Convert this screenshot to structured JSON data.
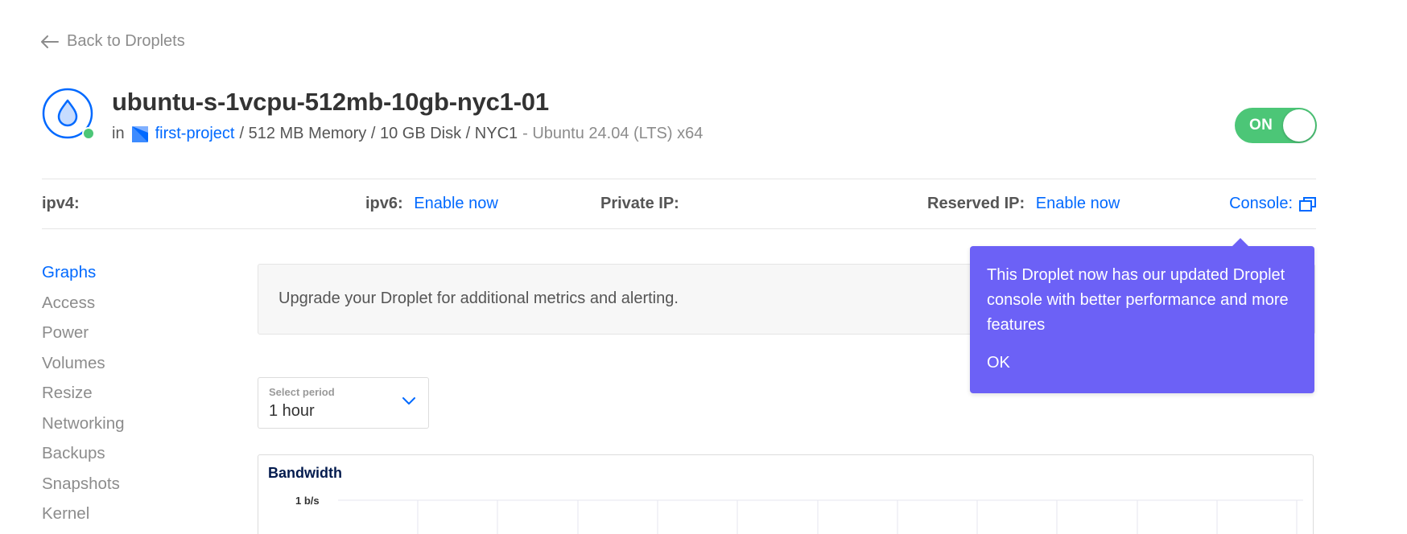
{
  "nav": {
    "back_label": "Back to Droplets"
  },
  "droplet": {
    "name": "ubuntu-s-1vcpu-512mb-10gb-nyc1-01",
    "in_label": "in",
    "project": "first-project",
    "specs": "/ 512 MB Memory / 10 GB Disk / NYC1",
    "os": "- Ubuntu 24.04 (LTS) x64",
    "status_color": "#4cc677"
  },
  "power_toggle": {
    "label": "ON",
    "state": "on",
    "color": "#4cc677"
  },
  "info_bar": {
    "ipv4_label": "ipv4:",
    "ipv6_label": "ipv6:",
    "ipv6_action": "Enable now",
    "private_ip_label": "Private IP:",
    "reserved_ip_label": "Reserved IP:",
    "reserved_ip_action": "Enable now",
    "console_label": "Console:"
  },
  "sidebar": {
    "items": [
      {
        "label": "Graphs",
        "active": true
      },
      {
        "label": "Access",
        "active": false
      },
      {
        "label": "Power",
        "active": false
      },
      {
        "label": "Volumes",
        "active": false
      },
      {
        "label": "Resize",
        "active": false
      },
      {
        "label": "Networking",
        "active": false
      },
      {
        "label": "Backups",
        "active": false
      },
      {
        "label": "Snapshots",
        "active": false
      },
      {
        "label": "Kernel",
        "active": false
      }
    ]
  },
  "banner": {
    "text": "Upgrade your Droplet for additional metrics and alerting."
  },
  "period_select": {
    "label": "Select period",
    "value": "1 hour"
  },
  "tooltip": {
    "message": "This Droplet now has our updated Droplet console with better performance and more features",
    "ok_label": "OK",
    "color": "#6c61f6"
  },
  "chart_data": {
    "type": "line",
    "title": "Bandwidth",
    "y_ticks": [
      "1 b/s"
    ],
    "series": [],
    "grid": true
  },
  "colors": {
    "accent": "#0069ff",
    "text": "#333333",
    "muted": "#8c8c8c"
  }
}
